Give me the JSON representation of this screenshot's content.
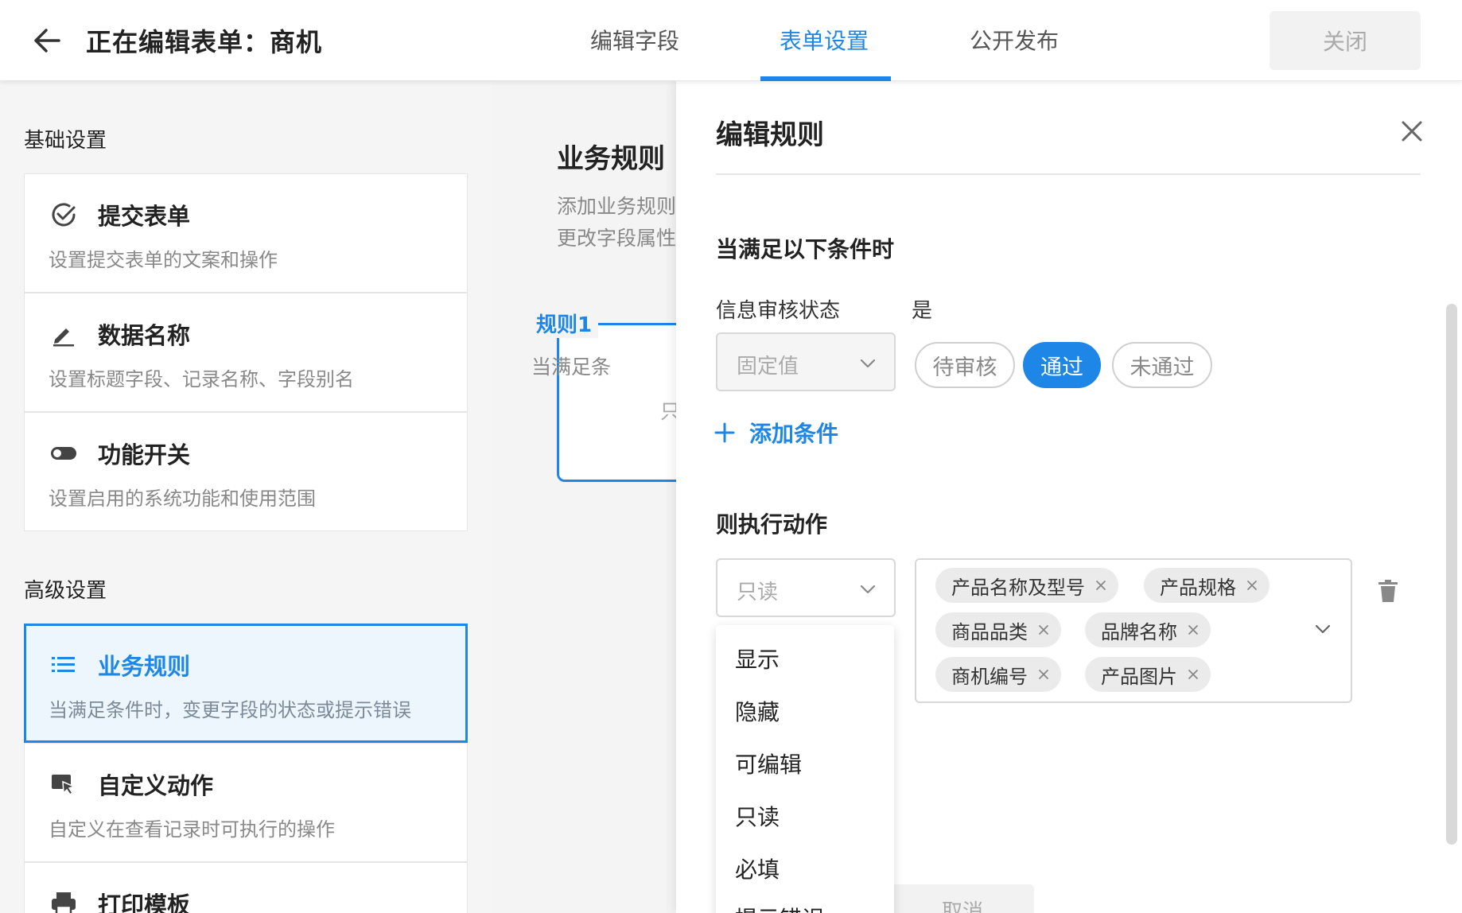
{
  "header": {
    "title": "正在编辑表单：商机",
    "tabs": [
      {
        "label": "编辑字段",
        "active": false
      },
      {
        "label": "表单设置",
        "active": true
      },
      {
        "label": "公开发布",
        "active": false
      }
    ],
    "close_label": "关闭"
  },
  "sidebar": {
    "basic_title": "基础设置",
    "advanced_title": "高级设置",
    "items": [
      {
        "icon": "check-circle-icon",
        "title": "提交表单",
        "desc": "设置提交表单的文案和操作"
      },
      {
        "icon": "pencil-icon",
        "title": "数据名称",
        "desc": "设置标题字段、记录名称、字段别名"
      },
      {
        "icon": "toggle-icon",
        "title": "功能开关",
        "desc": "设置启用的系统功能和使用范围"
      },
      {
        "icon": "list-icon",
        "title": "业务规则",
        "desc": "当满足条件时，变更字段的状态或提示错误",
        "active": true
      },
      {
        "icon": "cursor-window-icon",
        "title": "自定义动作",
        "desc": "自定义在查看记录时可执行的操作"
      },
      {
        "icon": "printer-icon",
        "title": "打印模板",
        "desc": ""
      }
    ]
  },
  "middle": {
    "title": "业务规则",
    "desc_line1": "添加业务规则",
    "desc_line2": "更改字段属性",
    "rule_name": "规则1",
    "rule_line1": "当满足条",
    "rule_line2": "只"
  },
  "drawer": {
    "title": "编辑规则",
    "condition_title": "当满足以下条件时",
    "condition_field": "信息审核状态",
    "condition_op": "是",
    "value_type": "固定值",
    "options": [
      {
        "label": "待审核",
        "active": false
      },
      {
        "label": "通过",
        "active": true
      },
      {
        "label": "未通过",
        "active": false
      }
    ],
    "add_condition": "添加条件",
    "action_title": "则执行动作",
    "action_select": "只读",
    "tags": [
      "产品名称及型号",
      "产品规格",
      "商品品类",
      "品牌名称",
      "商机编号",
      "产品图片"
    ],
    "cancel_label": "取消"
  },
  "dropdown": {
    "items": [
      "显示",
      "隐藏",
      "可编辑",
      "只读",
      "必填",
      "提示错误"
    ]
  },
  "colors": {
    "accent": "#1e86e6",
    "text": "#222222",
    "muted": "#888888"
  }
}
